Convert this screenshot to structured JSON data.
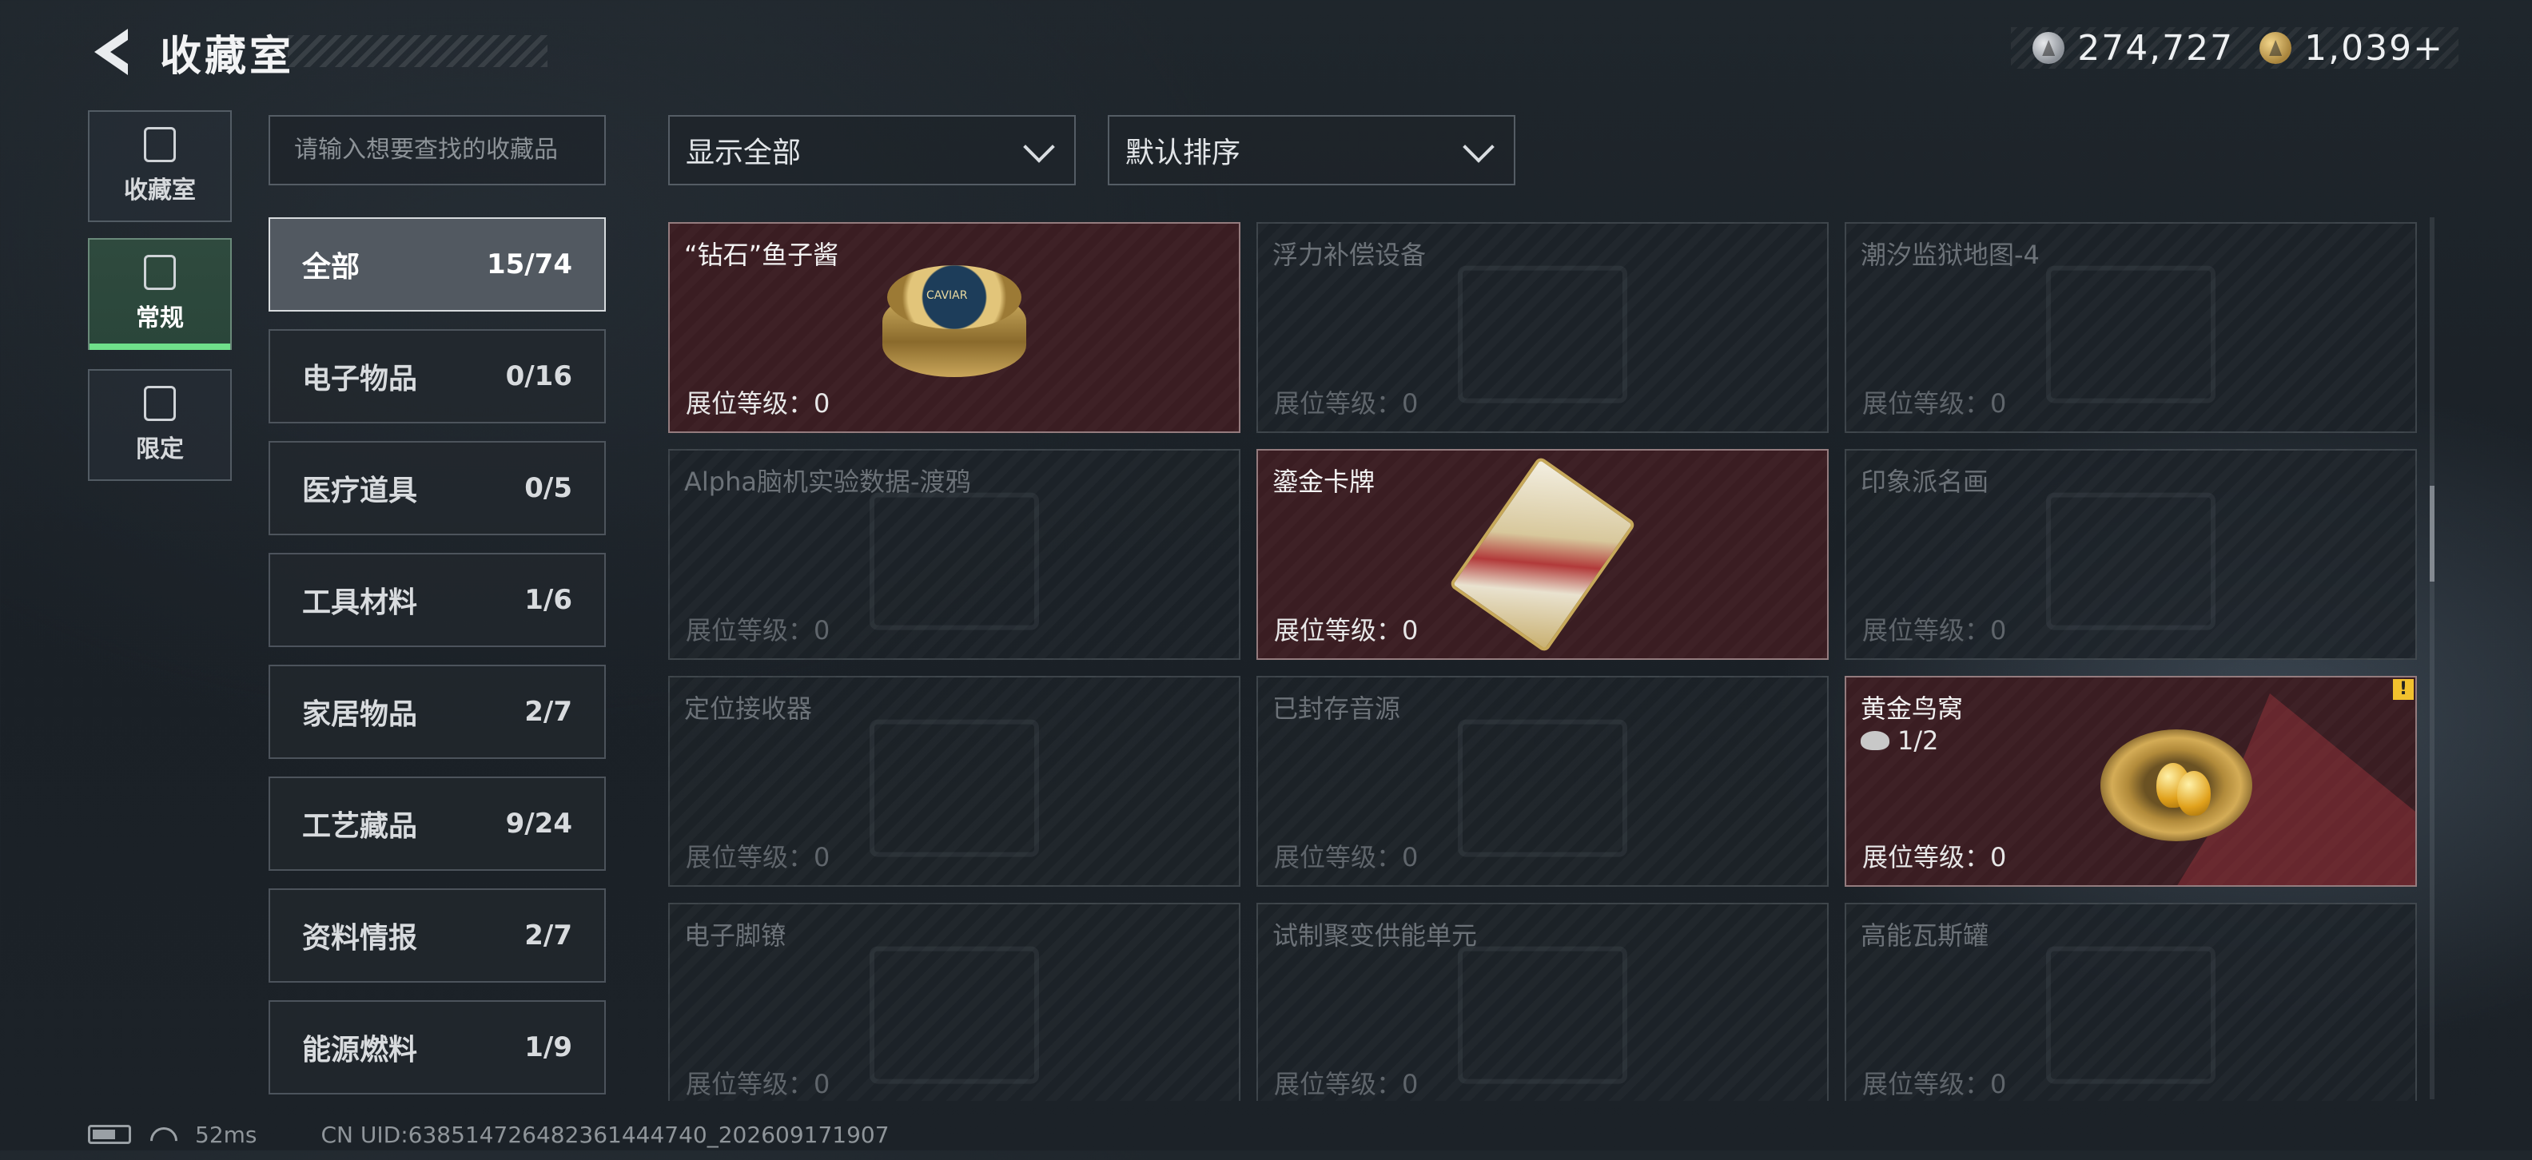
{
  "header": {
    "title": "收藏室",
    "currency": [
      {
        "icon": "silver-coin-icon",
        "value": "274,727"
      },
      {
        "icon": "gold-coin-icon",
        "value": "1,039+"
      }
    ]
  },
  "left_tabs": [
    {
      "label": "收藏室",
      "icon": "collection-room-icon",
      "active": false
    },
    {
      "label": "常规",
      "icon": "regular-icon",
      "active": true
    },
    {
      "label": "限定",
      "icon": "limited-icon",
      "active": false
    }
  ],
  "search": {
    "placeholder": "请输入想要查找的收藏品"
  },
  "categories": [
    {
      "name": "全部",
      "count": "15/74",
      "active": true
    },
    {
      "name": "电子物品",
      "count": "0/16"
    },
    {
      "name": "医疗道具",
      "count": "0/5"
    },
    {
      "name": "工具材料",
      "count": "1/6"
    },
    {
      "name": "家居物品",
      "count": "2/7"
    },
    {
      "name": "工艺藏品",
      "count": "9/24"
    },
    {
      "name": "资料情报",
      "count": "2/7"
    },
    {
      "name": "能源燃料",
      "count": "1/9"
    }
  ],
  "filters": {
    "display": "显示全部",
    "sort": "默认排序"
  },
  "items": [
    {
      "name": "“钻石”鱼子酱",
      "level": "展位等级：0",
      "owned": true,
      "art": "caviar"
    },
    {
      "name": "浮力补偿设备",
      "level": "展位等级：0",
      "owned": false
    },
    {
      "name": "潮汐监狱地图-4",
      "level": "展位等级：0",
      "owned": false
    },
    {
      "name": "Alpha脑机实验数据-渡鸦",
      "level": "展位等级：0",
      "owned": false
    },
    {
      "name": "鎏金卡牌",
      "level": "展位等级：0",
      "owned": true,
      "art": "card"
    },
    {
      "name": "印象派名画",
      "level": "展位等级：0",
      "owned": false
    },
    {
      "name": "定位接收器",
      "level": "展位等级：0",
      "owned": false
    },
    {
      "name": "已封存音源",
      "level": "展位等级：0",
      "owned": false
    },
    {
      "name": "黄金鸟窝",
      "level": "展位等级：0",
      "owned": true,
      "art": "nest",
      "count": "1/2",
      "alert": "!"
    },
    {
      "name": "电子脚镣",
      "level": "展位等级：0",
      "owned": false
    },
    {
      "name": "试制聚变供能单元",
      "level": "展位等级：0",
      "owned": false
    },
    {
      "name": "高能瓦斯罐",
      "level": "展位等级：0",
      "owned": false
    }
  ],
  "footer": {
    "ping": "52ms",
    "uid": "CN UID:638514726482361444740_202609171907"
  },
  "colors": {
    "owned_bg": "#3a1d22",
    "active_tab": "#6fe08a",
    "alert": "#f2c12e"
  }
}
